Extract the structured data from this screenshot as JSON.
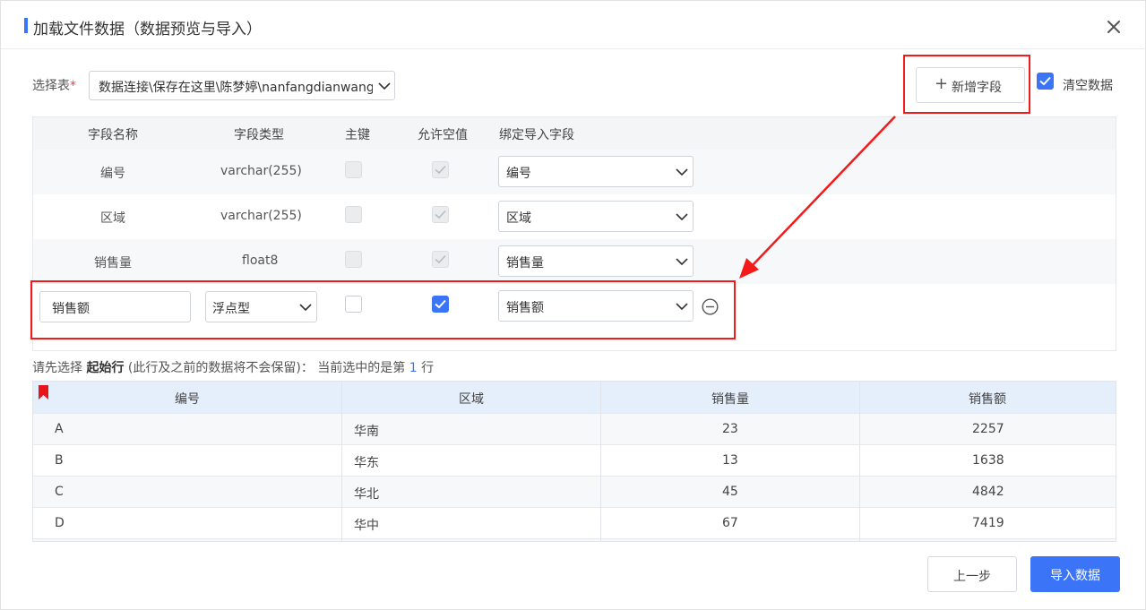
{
  "dialog": {
    "title": "加载文件数据（数据预览与导入）",
    "close_icon": "close-icon"
  },
  "table_select": {
    "label": "选择表",
    "required_mark": "*",
    "value": "数据连接\\保存在这里\\陈梦婷\\nanfangdianwang"
  },
  "toolbar": {
    "add_field_label": "新增字段",
    "add_field_icon": "plus-icon",
    "clear_data_label": "清空数据",
    "clear_data_checked": true
  },
  "fields": {
    "headers": [
      "字段名称",
      "字段类型",
      "主键",
      "允许空值",
      "绑定导入字段"
    ],
    "rows": [
      {
        "name": "编号",
        "type": "varchar(255)",
        "primary_key": false,
        "nullable": true,
        "bind": "编号"
      },
      {
        "name": "区域",
        "type": "varchar(255)",
        "primary_key": false,
        "nullable": true,
        "bind": "区域"
      },
      {
        "name": "销售量",
        "type": "float8",
        "primary_key": false,
        "nullable": true,
        "bind": "销售量"
      }
    ],
    "new_row": {
      "name": "销售额",
      "type": "浮点型",
      "primary_key": false,
      "nullable": true,
      "bind": "销售额",
      "remove_icon": "minus-circle-icon"
    }
  },
  "hint": {
    "prefix": "请先选择",
    "bold": "起始行",
    "middle": "(此行及之前的数据将不会保留)：  当前选中的是第",
    "row_number": "1",
    "suffix": "行"
  },
  "preview": {
    "headers": [
      "编号",
      "区域",
      "销售量",
      "销售额"
    ],
    "rows": [
      [
        "A",
        "华南",
        "23",
        "2257"
      ],
      [
        "B",
        "华东",
        "13",
        "1638"
      ],
      [
        "C",
        "华北",
        "45",
        "4842"
      ],
      [
        "D",
        "华中",
        "67",
        "7419"
      ]
    ],
    "marker_icon": "bookmark-icon"
  },
  "footer": {
    "back_label": "上一步",
    "import_label": "导入数据"
  },
  "colors": {
    "accent": "#3b74f6",
    "highlight": "#f41a1a"
  }
}
